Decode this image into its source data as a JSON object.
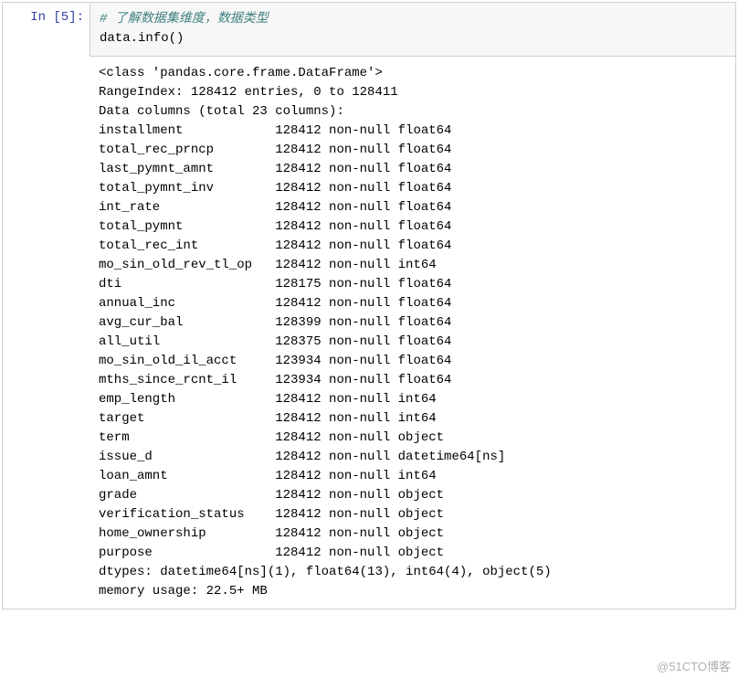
{
  "cell": {
    "prompt_label": "In  [5]:",
    "code_lines": [
      {
        "type": "comment",
        "text": "# 了解数据集维度，数据类型"
      },
      {
        "type": "code",
        "text": "data.info()"
      }
    ]
  },
  "output": {
    "header": [
      "<class 'pandas.core.frame.DataFrame'>",
      "RangeIndex: 128412 entries, 0 to 128411",
      "Data columns (total 23 columns):"
    ],
    "columns": [
      {
        "name": "installment",
        "count": "128412",
        "nullinfo": "non-null",
        "dtype": "float64"
      },
      {
        "name": "total_rec_prncp",
        "count": "128412",
        "nullinfo": "non-null",
        "dtype": "float64"
      },
      {
        "name": "last_pymnt_amnt",
        "count": "128412",
        "nullinfo": "non-null",
        "dtype": "float64"
      },
      {
        "name": "total_pymnt_inv",
        "count": "128412",
        "nullinfo": "non-null",
        "dtype": "float64"
      },
      {
        "name": "int_rate",
        "count": "128412",
        "nullinfo": "non-null",
        "dtype": "float64"
      },
      {
        "name": "total_pymnt",
        "count": "128412",
        "nullinfo": "non-null",
        "dtype": "float64"
      },
      {
        "name": "total_rec_int",
        "count": "128412",
        "nullinfo": "non-null",
        "dtype": "float64"
      },
      {
        "name": "mo_sin_old_rev_tl_op",
        "count": "128412",
        "nullinfo": "non-null",
        "dtype": "int64"
      },
      {
        "name": "dti",
        "count": "128175",
        "nullinfo": "non-null",
        "dtype": "float64"
      },
      {
        "name": "annual_inc",
        "count": "128412",
        "nullinfo": "non-null",
        "dtype": "float64"
      },
      {
        "name": "avg_cur_bal",
        "count": "128399",
        "nullinfo": "non-null",
        "dtype": "float64"
      },
      {
        "name": "all_util",
        "count": "128375",
        "nullinfo": "non-null",
        "dtype": "float64"
      },
      {
        "name": "mo_sin_old_il_acct",
        "count": "123934",
        "nullinfo": "non-null",
        "dtype": "float64"
      },
      {
        "name": "mths_since_rcnt_il",
        "count": "123934",
        "nullinfo": "non-null",
        "dtype": "float64"
      },
      {
        "name": "emp_length",
        "count": "128412",
        "nullinfo": "non-null",
        "dtype": "int64"
      },
      {
        "name": "target",
        "count": "128412",
        "nullinfo": "non-null",
        "dtype": "int64"
      },
      {
        "name": "term",
        "count": "128412",
        "nullinfo": "non-null",
        "dtype": "object"
      },
      {
        "name": "issue_d",
        "count": "128412",
        "nullinfo": "non-null",
        "dtype": "datetime64[ns]"
      },
      {
        "name": "loan_amnt",
        "count": "128412",
        "nullinfo": "non-null",
        "dtype": "int64"
      },
      {
        "name": "grade",
        "count": "128412",
        "nullinfo": "non-null",
        "dtype": "object"
      },
      {
        "name": "verification_status",
        "count": "128412",
        "nullinfo": "non-null",
        "dtype": "object"
      },
      {
        "name": "home_ownership",
        "count": "128412",
        "nullinfo": "non-null",
        "dtype": "object"
      },
      {
        "name": "purpose",
        "count": "128412",
        "nullinfo": "non-null",
        "dtype": "object"
      }
    ],
    "footer": [
      "dtypes: datetime64[ns](1), float64(13), int64(4), object(5)",
      "memory usage: 22.5+ MB"
    ]
  },
  "watermark": "@51CTO博客"
}
